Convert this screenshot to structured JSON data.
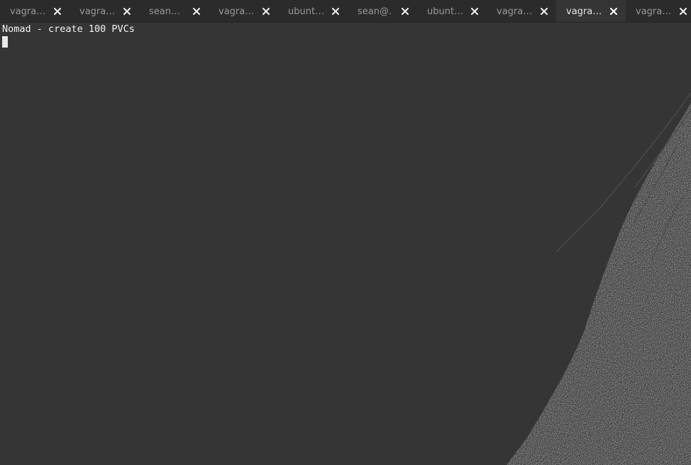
{
  "tabs": [
    {
      "label": "vagra…",
      "active": false
    },
    {
      "label": "vagra…",
      "active": false
    },
    {
      "label": "sean…",
      "active": false
    },
    {
      "label": "vagra…",
      "active": false
    },
    {
      "label": "ubunt…",
      "active": false
    },
    {
      "label": "sean@…",
      "active": false
    },
    {
      "label": "ubunt…",
      "active": false
    },
    {
      "label": "vagra…",
      "active": false
    },
    {
      "label": "vagra…",
      "active": true
    },
    {
      "label": "vagra…",
      "active": false
    }
  ],
  "terminal": {
    "line1": "Nomad - create 100 PVCs"
  },
  "colors": {
    "background": "#353535",
    "tabbar": "#2b2b2b",
    "text": "#f2f2f2"
  },
  "icons": {
    "tab_close": "close-icon",
    "cursor": "block-cursor"
  }
}
